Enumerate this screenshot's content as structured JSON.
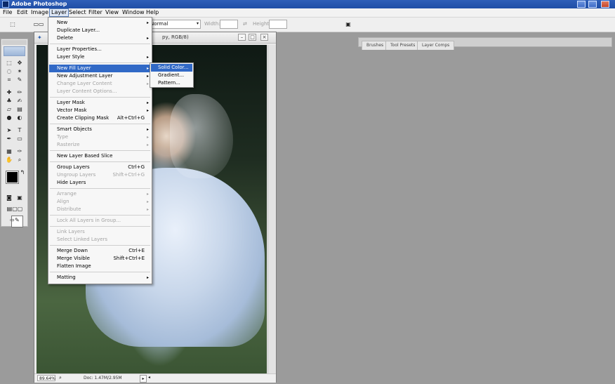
{
  "app": {
    "title": "Adobe Photoshop",
    "title_color": "#1f4ea6"
  },
  "menubar": {
    "items": [
      "File",
      "Edit",
      "Image",
      "Layer",
      "Select",
      "Filter",
      "View",
      "Window",
      "Help"
    ],
    "active": "Layer"
  },
  "options_bar": {
    "mode_value": "Normal",
    "width_label": "Width:",
    "height_label": "Height:"
  },
  "panel_well": {
    "tabs": [
      "Brushes",
      "Tool Presets",
      "Layer Comps"
    ]
  },
  "document": {
    "title_suffix": "py, RGB/8)",
    "zoom": "89.64%",
    "doc_info": "Doc: 1.47M/2.95M"
  },
  "layer_menu": {
    "items": [
      {
        "label": "New",
        "shortcut": "",
        "submenu": true,
        "disabled": false
      },
      {
        "label": "Duplicate Layer...",
        "shortcut": "",
        "submenu": false,
        "disabled": false
      },
      {
        "label": "Delete",
        "shortcut": "",
        "submenu": true,
        "disabled": false
      },
      {
        "label": "Layer Properties...",
        "shortcut": "",
        "submenu": false,
        "disabled": false
      },
      {
        "label": "Layer Style",
        "shortcut": "",
        "submenu": true,
        "disabled": false
      },
      {
        "label": "New Fill Layer",
        "shortcut": "",
        "submenu": true,
        "disabled": false,
        "highlighted": true
      },
      {
        "label": "New Adjustment Layer",
        "shortcut": "",
        "submenu": true,
        "disabled": false
      },
      {
        "label": "Change Layer Content",
        "shortcut": "",
        "submenu": true,
        "disabled": true
      },
      {
        "label": "Layer Content Options...",
        "shortcut": "",
        "submenu": false,
        "disabled": true
      },
      {
        "label": "Layer Mask",
        "shortcut": "",
        "submenu": true,
        "disabled": false
      },
      {
        "label": "Vector Mask",
        "shortcut": "",
        "submenu": true,
        "disabled": false
      },
      {
        "label": "Create Clipping Mask",
        "shortcut": "Alt+Ctrl+G",
        "submenu": false,
        "disabled": false
      },
      {
        "label": "Smart Objects",
        "shortcut": "",
        "submenu": true,
        "disabled": false
      },
      {
        "label": "Type",
        "shortcut": "",
        "submenu": true,
        "disabled": true
      },
      {
        "label": "Rasterize",
        "shortcut": "",
        "submenu": true,
        "disabled": true
      },
      {
        "label": "New Layer Based Slice",
        "shortcut": "",
        "submenu": false,
        "disabled": false
      },
      {
        "label": "Group Layers",
        "shortcut": "Ctrl+G",
        "submenu": false,
        "disabled": false
      },
      {
        "label": "Ungroup Layers",
        "shortcut": "Shift+Ctrl+G",
        "submenu": false,
        "disabled": true
      },
      {
        "label": "Hide Layers",
        "shortcut": "",
        "submenu": false,
        "disabled": false
      },
      {
        "label": "Arrange",
        "shortcut": "",
        "submenu": true,
        "disabled": true
      },
      {
        "label": "Align",
        "shortcut": "",
        "submenu": true,
        "disabled": true
      },
      {
        "label": "Distribute",
        "shortcut": "",
        "submenu": true,
        "disabled": true
      },
      {
        "label": "Lock All Layers in Group...",
        "shortcut": "",
        "submenu": false,
        "disabled": true
      },
      {
        "label": "Link Layers",
        "shortcut": "",
        "submenu": false,
        "disabled": true
      },
      {
        "label": "Select Linked Layers",
        "shortcut": "",
        "submenu": false,
        "disabled": true
      },
      {
        "label": "Merge Down",
        "shortcut": "Ctrl+E",
        "submenu": false,
        "disabled": false
      },
      {
        "label": "Merge Visible",
        "shortcut": "Shift+Ctrl+E",
        "submenu": false,
        "disabled": false
      },
      {
        "label": "Flatten Image",
        "shortcut": "",
        "submenu": false,
        "disabled": false
      },
      {
        "label": "Matting",
        "shortcut": "",
        "submenu": true,
        "disabled": false
      }
    ]
  },
  "fill_submenu": {
    "items": [
      {
        "label": "Solid Color...",
        "highlighted": true
      },
      {
        "label": "Gradient..."
      },
      {
        "label": "Pattern..."
      }
    ],
    "highlight_color": "#3169c6"
  }
}
